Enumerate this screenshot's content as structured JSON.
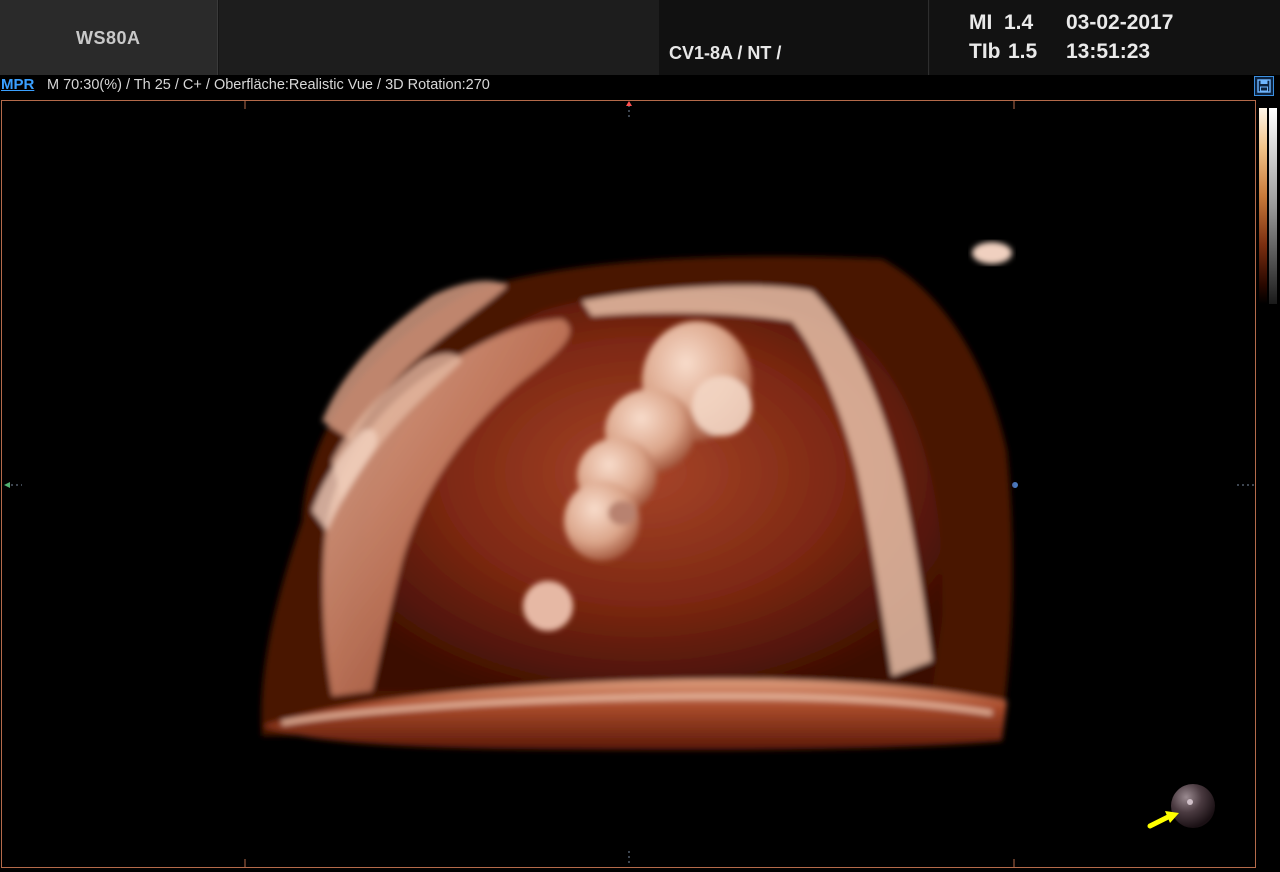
{
  "header": {
    "system_name": "WS80A",
    "probe_info": "CV1-8A / NT /",
    "mi_label": "MI",
    "mi_value": "1.4",
    "tib_label": "TIb",
    "tib_value": "1.5",
    "date": "03-02-2017",
    "time": "13:51:23"
  },
  "params_bar": {
    "mode_tab": "MPR",
    "params": "M 70:30(%) / Th 25 / C+ / Oberfläche:Realistic Vue / 3D Rotation:270"
  },
  "icons": {
    "save": "save-icon",
    "orientation": "orientation-ball-icon",
    "light_direction": "arrow-icon"
  },
  "colors": {
    "accent": "#3aa0ff",
    "frame_border": "#b46a4a",
    "indicator_arrow": "#ffff00",
    "tissue": "#7a2410"
  }
}
